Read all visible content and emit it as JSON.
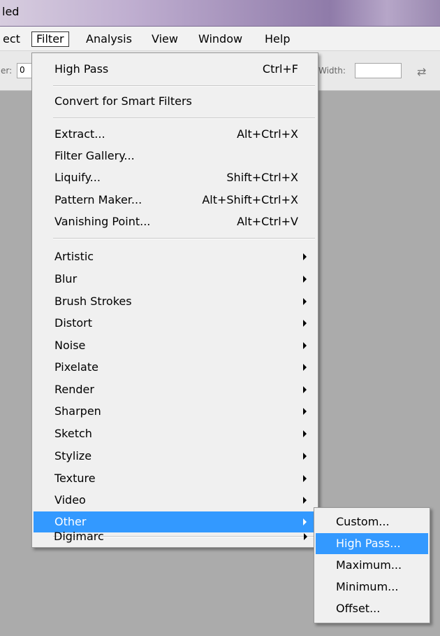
{
  "window": {
    "title_fragment": "led"
  },
  "menubar": {
    "items": [
      "ect",
      "Filter",
      "Analysis",
      "View",
      "Window",
      "Help"
    ],
    "active": "Filter"
  },
  "options_bar": {
    "left_label": "er:",
    "left_value": "0",
    "width_label": "Width:",
    "width_value": ""
  },
  "filter_menu": {
    "last_filter": {
      "label": "High Pass",
      "shortcut": "Ctrl+F"
    },
    "convert": "Convert for Smart Filters",
    "tools": [
      {
        "label": "Extract...",
        "shortcut": "Alt+Ctrl+X"
      },
      {
        "label": "Filter Gallery...",
        "shortcut": ""
      },
      {
        "label": "Liquify...",
        "shortcut": "Shift+Ctrl+X"
      },
      {
        "label": "Pattern Maker...",
        "shortcut": "Alt+Shift+Ctrl+X"
      },
      {
        "label": "Vanishing Point...",
        "shortcut": "Alt+Ctrl+V"
      }
    ],
    "categories": [
      "Artistic",
      "Blur",
      "Brush Strokes",
      "Distort",
      "Noise",
      "Pixelate",
      "Render",
      "Sharpen",
      "Sketch",
      "Stylize",
      "Texture",
      "Video",
      "Other"
    ],
    "highlighted_category": "Other",
    "plugins": [
      "Digimarc"
    ]
  },
  "other_submenu": {
    "items": [
      "Custom...",
      "High Pass...",
      "Maximum...",
      "Minimum...",
      "Offset..."
    ],
    "highlighted": "High Pass..."
  },
  "colors": {
    "highlight": "#3399ff",
    "menu_bg": "#f0f0f0",
    "workspace_bg": "#ababab"
  }
}
